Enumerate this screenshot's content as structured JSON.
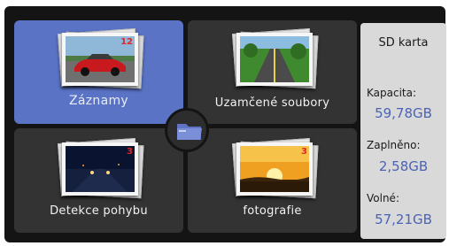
{
  "tiles": [
    {
      "label": "Záznamy",
      "count": "12"
    },
    {
      "label": "Uzamčené soubory",
      "count": ""
    },
    {
      "label": "Detekce pohybu",
      "count": "3"
    },
    {
      "label": "fotografie",
      "count": "3"
    }
  ],
  "sd": {
    "title": "SD karta",
    "capacity_label": "Kapacita:",
    "capacity_value": "59,78GB",
    "used_label": "Zaplněno:",
    "used_value": "2,58GB",
    "free_label": "Volné:",
    "free_value": "57,21GB"
  },
  "colors": {
    "active_tile": "#5a73c5",
    "tile": "#333333",
    "screen_bg": "#141414",
    "count": "#e0262a",
    "sd_value": "#4a63b5"
  },
  "icons": {
    "center": "folder-icon"
  }
}
